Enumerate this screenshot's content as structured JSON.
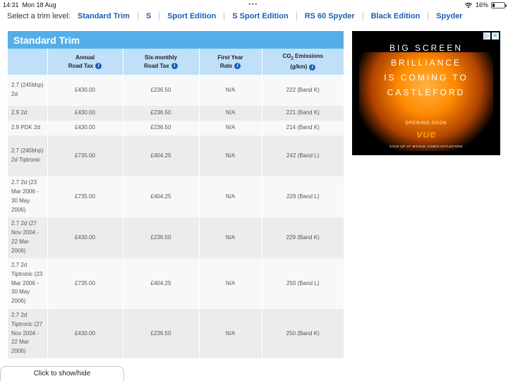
{
  "status_bar": {
    "time": "14:31",
    "date": "Mon 18 Aug",
    "multitask_dots": "•••",
    "battery": "16%",
    "battery_level": 0.16
  },
  "trim_nav": {
    "label": "Select a trim level:",
    "links": [
      "Standard Trim",
      "S",
      "Sport Edition",
      "S Sport Edition",
      "RS 60 Spyder",
      "Black Edition",
      "Spyder"
    ]
  },
  "panel": {
    "title": "Standard Trim",
    "headers": {
      "annual_1": "Annual",
      "annual_2": "Road Tax",
      "six_1": "Six-monthly",
      "six_2": "Road Tax",
      "first_1": "First Year",
      "first_2": "Rate",
      "co2_1": "CO",
      "co2_sub": "2",
      "co2_1b": " Emissions",
      "co2_2": "(g/km)"
    },
    "info_icon": "i",
    "rows": [
      {
        "model": "2.7 (245bhp) 2d",
        "annual": "£430.00",
        "six": "£236.50",
        "first": "N/A",
        "co2": "222 (Band K)"
      },
      {
        "model": "2.9 2d",
        "annual": "£430.00",
        "six": "£236.50",
        "first": "N/A",
        "co2": "221 (Band K)"
      },
      {
        "model": "2.9 PDK 2d",
        "annual": "£430.00",
        "six": "£236.50",
        "first": "N/A",
        "co2": "214 (Band K)"
      },
      {
        "model": "2.7 (245bhp) 2d Tiptronic",
        "annual": "£735.00",
        "six": "£404.25",
        "first": "N/A",
        "co2": "242 (Band L)"
      },
      {
        "model": "2.7 2d (23 Mar 2006 - 30 May 2006)",
        "annual": "£735.00",
        "six": "£404.25",
        "first": "N/A",
        "co2": "229 (Band L)"
      },
      {
        "model": "2.7 2d (27 Nov 2004 - 22 Mar 2006)",
        "annual": "£430.00",
        "six": "£236.50",
        "first": "N/A",
        "co2": "229 (Band K)"
      },
      {
        "model": "2.7 2d Tiptronic (23 Mar 2006 - 30 May 2006)",
        "annual": "£735.00",
        "six": "£404.25",
        "first": "N/A",
        "co2": "250 (Band L)"
      },
      {
        "model": "2.7 2d Tiptronic (27 Nov 2004 - 22 Mar 2006)",
        "annual": "£430.00",
        "six": "£236.50",
        "first": "N/A",
        "co2": "250 (Band K)"
      }
    ]
  },
  "ad": {
    "headline_lines": [
      "BIG SCREEN",
      "BRILLIANCE",
      "IS COMING TO",
      "CASTLEFORD"
    ],
    "opening": "OPENING SOON",
    "brand": "vue",
    "signup": "SIGN UP AT MYVUE.COM/CASTLEFORD",
    "adchoices_icon": "▷",
    "close_icon": "✕"
  },
  "toggle_button": {
    "label": "Click to show/hide"
  },
  "colors": {
    "header_blue": "#55aee8",
    "header_light": "#bfe0f8",
    "link": "#1a5fb4",
    "ad_orange": "#f39200"
  }
}
